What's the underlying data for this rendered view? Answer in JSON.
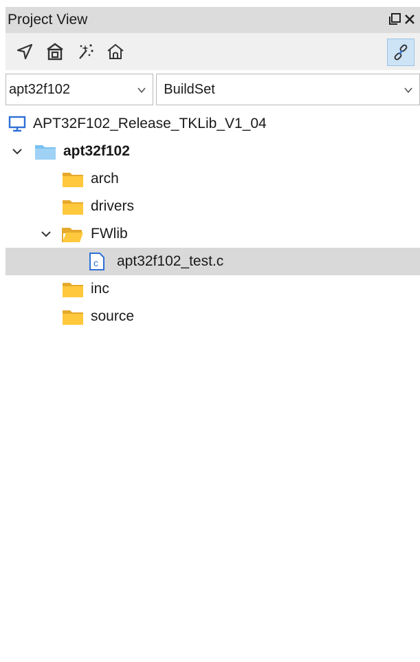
{
  "panel": {
    "title": "Project View",
    "float_icon": "restore-window-icon",
    "close_icon": "close-icon"
  },
  "toolbar": {
    "buttons": [
      {
        "icon": "locate-arrow-icon"
      },
      {
        "icon": "home-building-icon"
      },
      {
        "icon": "sparkle-wand-icon"
      },
      {
        "icon": "home-outline-icon"
      }
    ],
    "link_button": {
      "icon": "link-sync-icon",
      "active": true
    }
  },
  "selectors": {
    "project": "apt32f102",
    "build": "BuildSet"
  },
  "tree": {
    "root": {
      "label": "APT32F102_Release_TKLib_V1_04",
      "icon": "computer-icon"
    },
    "project": {
      "label": "apt32f102",
      "expanded": true
    },
    "folders": [
      {
        "label": "arch",
        "expanded": false
      },
      {
        "label": "drivers",
        "expanded": false
      },
      {
        "label": "FWlib",
        "expanded": true
      },
      {
        "label": "inc",
        "expanded": false
      },
      {
        "label": "source",
        "expanded": false
      }
    ],
    "files": [
      {
        "label": "apt32f102_test.c",
        "icon": "c-file-icon",
        "selected": true
      }
    ]
  },
  "colors": {
    "titlebar_bg": "#dcdcdc",
    "toolbar_bg": "#f0f0f0",
    "selection_bg": "#d9d9d9",
    "folder_yellow": "#ffc83d",
    "project_blue": "#79c1f1",
    "computer_blue": "#2e6fd6"
  }
}
